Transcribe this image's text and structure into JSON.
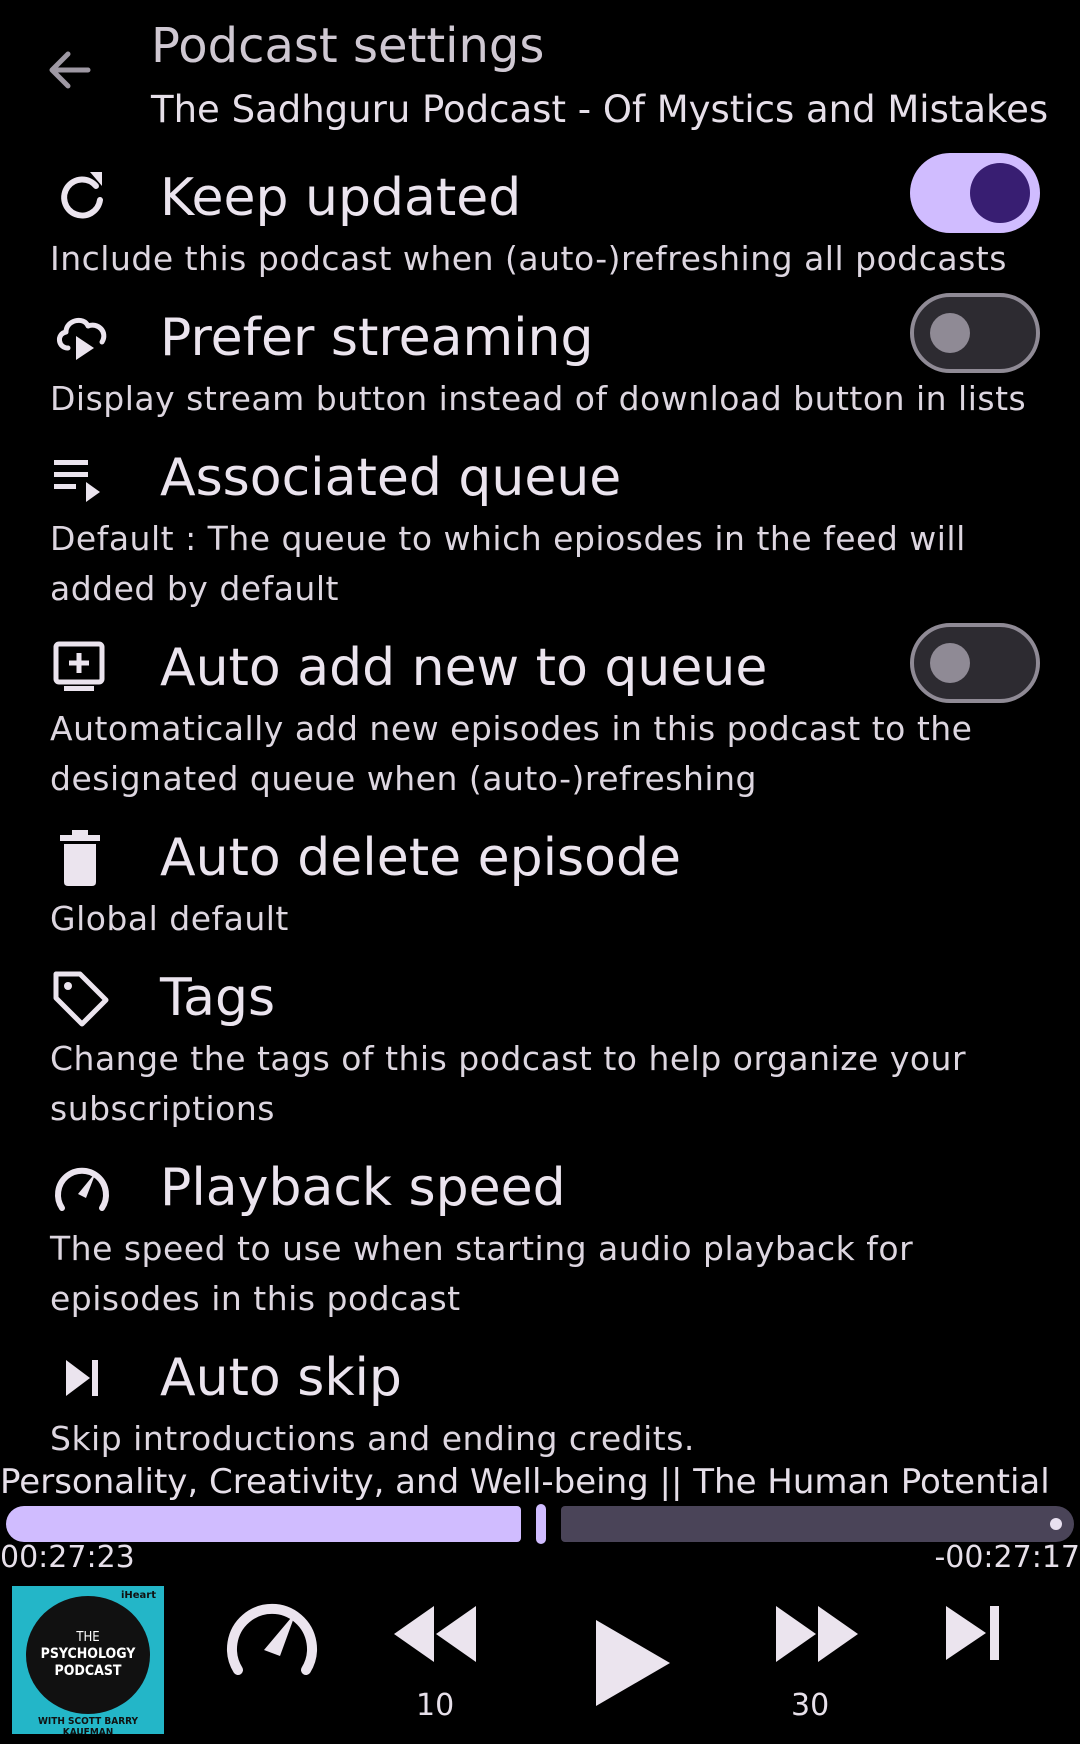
{
  "header": {
    "title": "Podcast settings",
    "subtitle": "The Sadhguru Podcast - Of Mystics and Mistakes"
  },
  "settings": [
    {
      "icon": "refresh-icon",
      "title": "Keep updated",
      "description": "Include this podcast when (auto-)refreshing all podcasts",
      "switch": "on"
    },
    {
      "icon": "cloud-stream-icon",
      "title": "Prefer streaming",
      "description": "Display stream button instead of download button in lists",
      "switch": "off"
    },
    {
      "icon": "queue-play-icon",
      "title": "Associated queue",
      "description": "Default : The queue to which epiosdes in the feed will added by default"
    },
    {
      "icon": "add-to-queue-icon",
      "title": "Auto add new to queue",
      "description": "Automatically add new episodes in this podcast to the designated queue when (auto-)refreshing",
      "switch": "off"
    },
    {
      "icon": "trash-icon",
      "title": "Auto delete episode",
      "description": "Global default"
    },
    {
      "icon": "tag-icon",
      "title": "Tags",
      "description": "Change the tags of this podcast to help organize your subscriptions"
    },
    {
      "icon": "speedometer-icon",
      "title": "Playback speed",
      "description": "The speed to use when starting audio playback for episodes in this podcast"
    },
    {
      "icon": "skip-next-icon",
      "title": "Auto skip",
      "description": "Skip introductions and ending credits."
    }
  ],
  "player": {
    "episode_title": "Personality, Creativity, and Well-being || The Human Potential",
    "elapsed": "00:27:23",
    "remaining": "-00:27:17",
    "progress_fraction": 0.5,
    "rewind_label": "10",
    "forward_label": "30",
    "cover": {
      "line1": "THE",
      "line2": "PSYCHOLOGY",
      "line3": "PODCAST",
      "line4": "WITH SCOTT BARRY KAUFMAN",
      "badge": "iHeart"
    }
  },
  "colors": {
    "accent": "#d0bcff",
    "accent_dark": "#381e72",
    "background": "#000000",
    "track": "#4a4458"
  }
}
